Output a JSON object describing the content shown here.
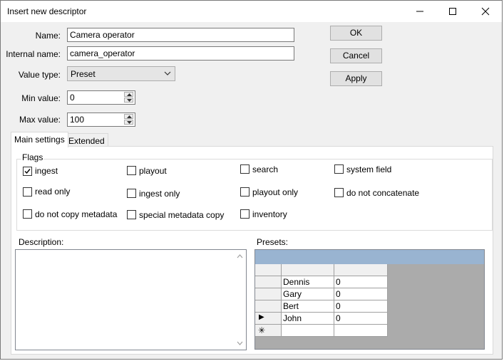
{
  "window": {
    "title": "Insert new descriptor"
  },
  "form": {
    "name_label": "Name:",
    "name_value": "Camera operator",
    "internal_name_label": "Internal name:",
    "internal_name_value": "camera_operator",
    "value_type_label": "Value type:",
    "value_type_value": "Preset",
    "min_value_label": "Min value:",
    "min_value": "0",
    "max_value_label": "Max value:",
    "max_value": "100"
  },
  "buttons": {
    "ok": "OK",
    "cancel": "Cancel",
    "apply": "Apply"
  },
  "tabs": [
    {
      "label": "Main settings",
      "active": true
    },
    {
      "label": "Extended",
      "active": false
    }
  ],
  "flags": {
    "title": "Flags",
    "items": [
      {
        "label": "ingest",
        "checked": true
      },
      {
        "label": "playout",
        "checked": false
      },
      {
        "label": "search",
        "checked": false
      },
      {
        "label": "system field",
        "checked": false
      },
      {
        "label": "read only",
        "checked": false
      },
      {
        "label": "ingest only",
        "checked": false
      },
      {
        "label": "playout only",
        "checked": false
      },
      {
        "label": "do not concatenate",
        "checked": false
      },
      {
        "label": "do not copy metadata",
        "checked": false
      },
      {
        "label": "special metadata copy",
        "checked": false
      },
      {
        "label": "inventory",
        "checked": false
      }
    ]
  },
  "description": {
    "label": "Description:",
    "value": ""
  },
  "presets": {
    "label": "Presets:",
    "rows": [
      {
        "name": "Dennis",
        "value": "0"
      },
      {
        "name": "Gary",
        "value": "0"
      },
      {
        "name": "Bert",
        "value": "0"
      },
      {
        "name": "John",
        "value": "0"
      }
    ],
    "current_row_marker": "▶",
    "new_row_marker": "✳"
  }
}
